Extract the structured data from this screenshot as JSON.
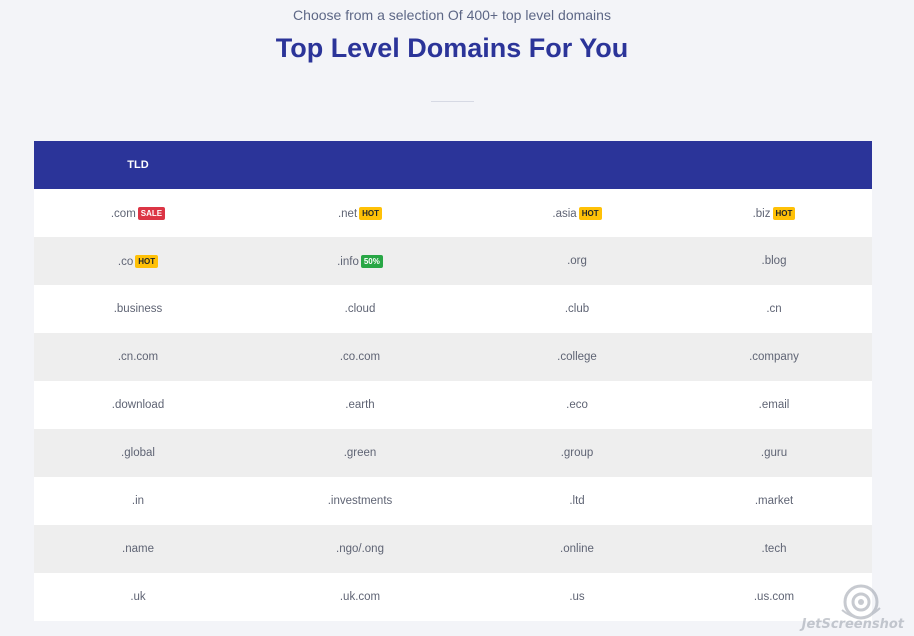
{
  "header": {
    "subtitle": "Choose from a selection Of 400+ top level domains",
    "title": "Top Level Domains For You"
  },
  "table": {
    "header_label": "TLD",
    "rows": [
      [
        {
          "tld": ".com",
          "badge": "SALE",
          "badge_type": "sale"
        },
        {
          "tld": ".net",
          "badge": "HOT",
          "badge_type": "hot"
        },
        {
          "tld": ".asia",
          "badge": "HOT",
          "badge_type": "hot"
        },
        {
          "tld": ".biz",
          "badge": "HOT",
          "badge_type": "hot"
        }
      ],
      [
        {
          "tld": ".co",
          "badge": "HOT",
          "badge_type": "hot"
        },
        {
          "tld": ".info",
          "badge": "50%",
          "badge_type": "pct"
        },
        {
          "tld": ".org"
        },
        {
          "tld": ".blog"
        }
      ],
      [
        {
          "tld": ".business"
        },
        {
          "tld": ".cloud"
        },
        {
          "tld": ".club"
        },
        {
          "tld": ".cn"
        }
      ],
      [
        {
          "tld": ".cn.com"
        },
        {
          "tld": ".co.com"
        },
        {
          "tld": ".college"
        },
        {
          "tld": ".company"
        }
      ],
      [
        {
          "tld": ".download"
        },
        {
          "tld": ".earth"
        },
        {
          "tld": ".eco"
        },
        {
          "tld": ".email"
        }
      ],
      [
        {
          "tld": ".global"
        },
        {
          "tld": ".green"
        },
        {
          "tld": ".group"
        },
        {
          "tld": ".guru"
        }
      ],
      [
        {
          "tld": ".in"
        },
        {
          "tld": ".investments"
        },
        {
          "tld": ".ltd"
        },
        {
          "tld": ".market"
        }
      ],
      [
        {
          "tld": ".name"
        },
        {
          "tld": ".ngo/.ong"
        },
        {
          "tld": ".online"
        },
        {
          "tld": ".tech"
        }
      ],
      [
        {
          "tld": ".uk"
        },
        {
          "tld": ".uk.com"
        },
        {
          "tld": ".us"
        },
        {
          "tld": ".us.com"
        }
      ]
    ]
  },
  "watermark": {
    "text": "JetScreenshot",
    "icon": "camera-swirl-icon"
  },
  "colors": {
    "title": "#2b3499",
    "table_header": "#2b3499",
    "sale": "#dc3545",
    "hot": "#ffc107",
    "pct": "#28a745"
  }
}
